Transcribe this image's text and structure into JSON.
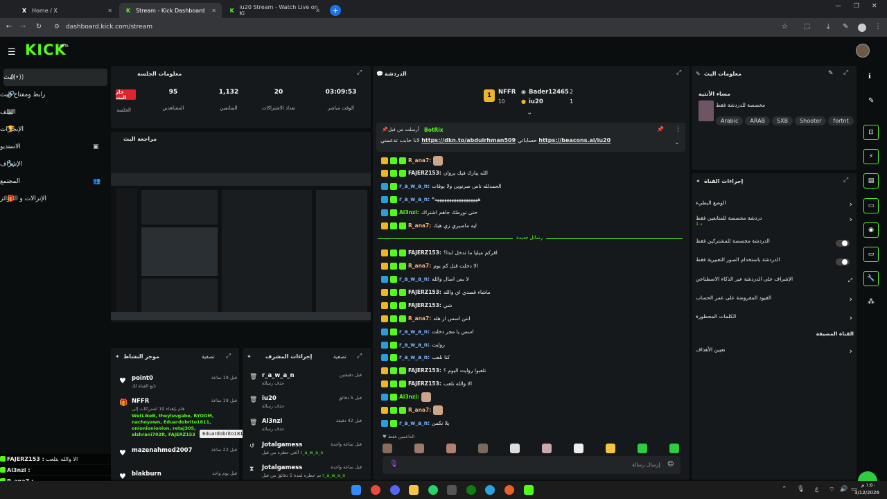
{
  "browser": {
    "tabs": [
      {
        "title": "Home / X"
      },
      {
        "title": "Stream - Kick Dashboard"
      },
      {
        "title": "iu20 Stream - Watch Live on Ki"
      }
    ],
    "url": "dashboard.kick.com/stream"
  },
  "header": {
    "logo": "KICK",
    "logo_badge": "BETA"
  },
  "nav": {
    "items": [
      {
        "label": "البث"
      },
      {
        "label": "رابط ومفتاح البث"
      },
      {
        "label": "الملف"
      },
      {
        "label": "الإنجازات"
      },
      {
        "label": "الاستديو"
      },
      {
        "label": "الإشراف"
      },
      {
        "label": "المجتمع"
      },
      {
        "label": "الإنزالات و الجوائز"
      }
    ]
  },
  "session": {
    "title": "معلومات الجلسة",
    "live_badge": "جار البث",
    "session_label": "الجلسة",
    "stats": [
      {
        "value": "95",
        "label": "المشاهدين"
      },
      {
        "value": "1,132",
        "label": "المتابعين"
      },
      {
        "value": "20",
        "label": "تعداد الاشتراكات"
      },
      {
        "value": "03:09:53",
        "label": "الوقت مباشر"
      }
    ]
  },
  "preview": {
    "title": "مراجعة البث"
  },
  "activity": {
    "title": "موجز النشاط",
    "filter": "تصفية",
    "items": [
      {
        "name": "point0",
        "sub": "تابع القناة لك",
        "time": "قبل 19 ساعة"
      },
      {
        "name": "NFFR",
        "sub": "قام بإهداء 10 اشتراكات إلى",
        "time": "قبل 19 ساعة",
        "gifted": "WetLikeB, theyluvgabe, RYOOM, nachoyawn, Eduardobrito1811, onionionionion, retaj305, alzhrani702R, FAJERZ153"
      },
      {
        "name": "mazenahmed2007",
        "time": "قبل 22 ساعة"
      },
      {
        "name": "blakburn",
        "time": "قبل يوم واحد"
      }
    ],
    "tooltip": "Eduardobrito1811"
  },
  "modactions": {
    "title": "إجراءات المشرف",
    "filter": "تصفية",
    "items": [
      {
        "name": "r_a_w_a_n",
        "sub": "حذف رسالة",
        "time": "قبل دقيقتين"
      },
      {
        "name": "iu20",
        "sub": "حذف رسالة",
        "time": "قبل 5 دقائق"
      },
      {
        "name": "Al3nzi",
        "sub": "حذف رسالة",
        "time": "قبل 42 دقيقة"
      },
      {
        "name": "Jotalgamess",
        "sub": "ألغى حظره من قبل",
        "by": "r_a_w_a_n",
        "time": "قبل ساعة واحدة"
      },
      {
        "name": "Jotalgamess",
        "sub": "تم حظره لمدة 5 دقائق من قبل",
        "by": "r_a_w_a_n",
        "time": "قبل ساعة واحدة"
      }
    ]
  },
  "chat": {
    "title": "الدردشة",
    "top": {
      "left_name": "NFFR",
      "left_count": "10",
      "left_rank": "1",
      "right_name1": "Bader12465",
      "right_val1": "2",
      "right_name2": "iu20",
      "right_val2": "1"
    },
    "pinned": {
      "pinned_by": "أرسلت من قبل",
      "bot": "BotRix",
      "text_a": "https://dkn.to/abduirhman509",
      "text_b": "حساباتي",
      "text_c": "https://beacons.ai/iu20",
      "text_d": "لانا حابب تدعمني"
    },
    "new_messages": "رسائل جديدة",
    "lines": [
      {
        "user": "R_ana7:",
        "color": "#f7b27a",
        "msg": "",
        "emote": true,
        "badges": [
          "crown",
          "sub",
          "sub"
        ]
      },
      {
        "user": "FAJERZ153:",
        "color": "#e8e8e8",
        "msg": "الله يبارك فيك يروان",
        "badges": [
          "crown",
          "sub",
          "sub"
        ]
      },
      {
        "user": "r_a_w_a_n:",
        "color": "#7fb8ff",
        "msg": "الحمدلله ناس صرنوين ولا يوقات",
        "badges": [
          "vip",
          "sub"
        ]
      },
      {
        "user": "r_a_w_a_n:",
        "color": "#7fb8ff",
        "msg": "*ههههههههههههههههههه",
        "badges": [
          "vip",
          "sub"
        ]
      },
      {
        "user": "Al3nzi:",
        "color": "#53fc18",
        "msg": "حتى تورطك جاهم اشتراك",
        "badges": [
          "vip",
          "sub"
        ]
      },
      {
        "user": "R_ana7:",
        "color": "#f7b27a",
        "msg": "ليه ماصيري زي هيك",
        "badges": [
          "crown",
          "sub",
          "sub"
        ]
      },
      {
        "user": "FAJERZ153:",
        "color": "#e8e8e8",
        "msg": "اقركم ميليا ما تدخل ابدا؟",
        "badges": [
          "crown",
          "sub",
          "sub"
        ]
      },
      {
        "user": "R_ana7:",
        "color": "#f7b27a",
        "msg": "الا دخلت قبل كم يوم",
        "badges": [
          "crown",
          "sub",
          "sub"
        ]
      },
      {
        "user": "r_a_w_a_n:",
        "color": "#7fb8ff",
        "msg": "لا بس اسال والله",
        "badges": [
          "vip",
          "sub"
        ]
      },
      {
        "user": "FAJERZ153:",
        "color": "#e8e8e8",
        "msg": "ماشاء قصدي اي والله",
        "badges": [
          "crown",
          "sub",
          "sub"
        ]
      },
      {
        "user": "FAJERZ153:",
        "color": "#e8e8e8",
        "msg": "شي",
        "badges": [
          "crown",
          "sub",
          "sub"
        ]
      },
      {
        "user": "R_ana7:",
        "color": "#f7b27a",
        "msg": "انتن اسس از هله",
        "badges": [
          "crown",
          "sub",
          "sub"
        ]
      },
      {
        "user": "r_a_w_a_n:",
        "color": "#7fb8ff",
        "msg": "اسس يا مجر دخلت",
        "badges": [
          "vip",
          "sub"
        ]
      },
      {
        "user": "r_a_w_a_n:",
        "color": "#7fb8ff",
        "msg": "روايت",
        "badges": [
          "vip",
          "sub"
        ]
      },
      {
        "user": "r_a_w_a_n:",
        "color": "#7fb8ff",
        "msg": "كنا نلعب",
        "badges": [
          "vip",
          "sub"
        ]
      },
      {
        "user": "FAJERZ153:",
        "color": "#e8e8e8",
        "msg": "تلعبوا روايت اليوم ؟",
        "badges": [
          "crown",
          "sub",
          "sub"
        ]
      },
      {
        "user": "FAJERZ153:",
        "color": "#e8e8e8",
        "msg": "الا والله نلعب",
        "badges": [
          "crown",
          "sub",
          "sub"
        ]
      },
      {
        "user": "Al3nzi:",
        "color": "#53fc18",
        "msg": "",
        "emote": true,
        "badges": [
          "vip",
          "sub"
        ]
      },
      {
        "user": "R_ana7:",
        "color": "#f7b27a",
        "msg": "",
        "emote": true,
        "badges": [
          "crown",
          "sub",
          "sub"
        ]
      },
      {
        "user": "r_a_w_a_n:",
        "color": "#7fb8ff",
        "msg": "يلا نكمن",
        "badges": [
          "vip",
          "sub"
        ]
      }
    ],
    "supporters_label": "الداعمين فقط",
    "input_placeholder": "إرسال رسالة"
  },
  "stream_info": {
    "title": "معلومات البث",
    "stream_title": "مساء الأنثيه",
    "subtitle": "مخصصة للدردشة فقط",
    "tags": [
      "Arabic",
      "ARAB",
      "SXB",
      "Shooter",
      "fortnt"
    ]
  },
  "channel_actions": {
    "title": "إجراءات القناة",
    "rows": [
      {
        "label": "الوضع البطيء",
        "type": "chevron"
      },
      {
        "label": "دردشة مخصصة للمتابعين فقط",
        "sub": "1 د",
        "type": "chevron"
      },
      {
        "label": "الدردشة مخصصة للمشتركين فقط",
        "type": "toggle"
      },
      {
        "label": "الدردشة باستخدام الصور التعبيرية فقط",
        "type": "toggle"
      },
      {
        "label": "الإشراف على الدردشة عبر الذكاء الاصطناعي",
        "type": "link"
      },
      {
        "label": "القيود المفروضة على عمر الحساب",
        "type": "chevron"
      },
      {
        "label": "الكلمات المحظورة",
        "type": "chevron"
      },
      {
        "label": "القناة المضيفة",
        "type": "none"
      },
      {
        "label": "تعيين الأهداف",
        "type": "chevron"
      }
    ]
  },
  "overlay_chat": [
    {
      "user": "FAJERZ153 :",
      "msg": "الا والله بتلعب"
    },
    {
      "user": "Al3nzi :",
      "msg": ""
    },
    {
      "user": "R_ana7 :",
      "msg": ""
    },
    {
      "user": "r_a_w_a_n :",
      "msg": "يلا نكمن"
    }
  ],
  "taskbar": {
    "time": "١:٥٠ م",
    "date": "3/12/2026",
    "lang": "ع"
  },
  "colors": {
    "accent": "#53fc18",
    "live": "#e0242d",
    "bg": "#0b0e0f",
    "panel": "#16191b"
  }
}
